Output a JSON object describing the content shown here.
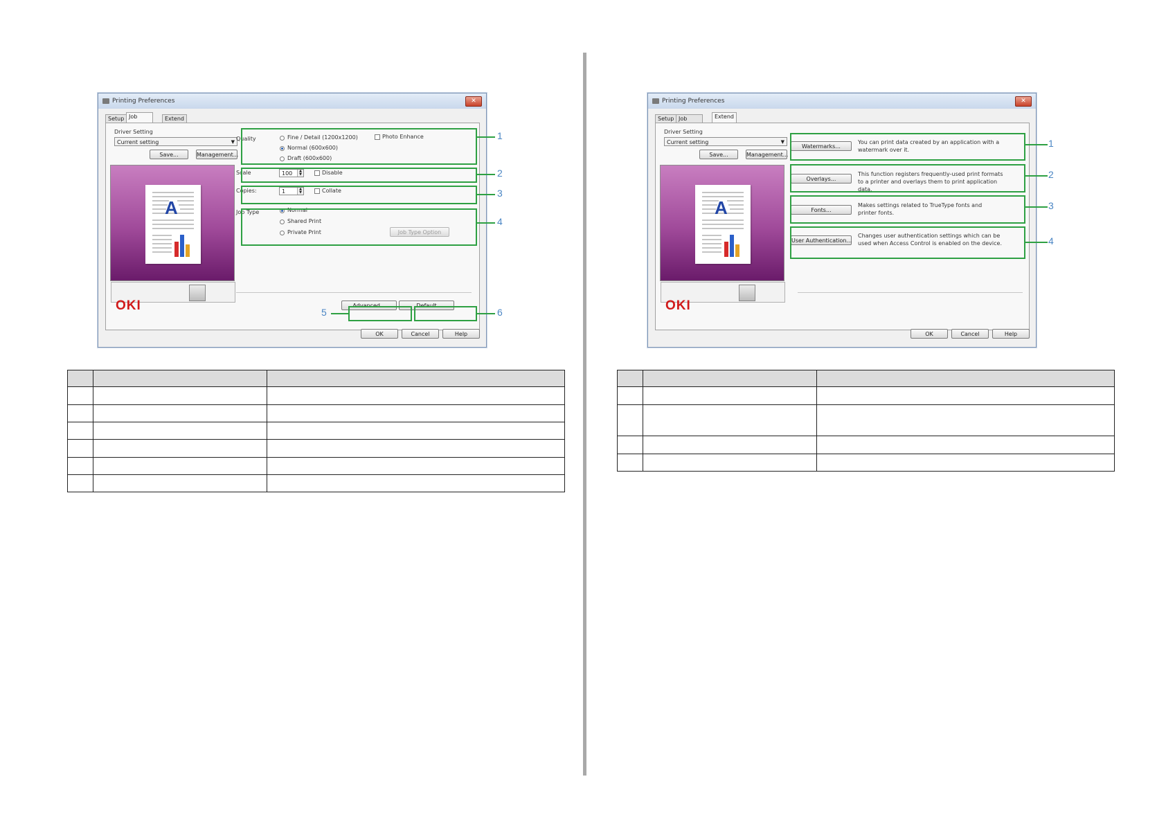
{
  "left": {
    "window_title": "Printing Preferences",
    "close_glyph": "✕",
    "tabs": [
      "Setup",
      "Job Options",
      "Extend"
    ],
    "driver_setting_label": "Driver Setting",
    "driver_setting_value": "Current setting",
    "save_label": "Save...",
    "management_label": "Management...",
    "quality_label": "Quality",
    "quality_options": [
      "Fine / Detail (1200x1200)",
      "Normal (600x600)",
      "Draft (600x600)"
    ],
    "photo_enhance_label": "Photo Enhance",
    "scale_label": "Scale",
    "scale_value": "100",
    "disable_label": "Disable",
    "copies_label": "Copies:",
    "copies_value": "1",
    "collate_label": "Collate",
    "job_type_label": "Job Type",
    "job_type_options": [
      "Normal",
      "Shared Print",
      "Private Print"
    ],
    "job_type_option_button": "Job Type Option",
    "advanced_label": "Advanced...",
    "default_label": "Default",
    "ok_label": "OK",
    "cancel_label": "Cancel",
    "help_label": "Help",
    "logo": "OKI",
    "preview_letter": "A",
    "callouts": [
      "1",
      "2",
      "3",
      "4",
      "5",
      "6"
    ]
  },
  "right": {
    "window_title": "Printing Preferences",
    "close_glyph": "✕",
    "tabs": [
      "Setup",
      "Job Options",
      "Extend"
    ],
    "driver_setting_label": "Driver Setting",
    "driver_setting_value": "Current setting",
    "save_label": "Save...",
    "management_label": "Management...",
    "watermarks_label": "Watermarks...",
    "watermarks_desc": "You can print data created by an application with a watermark over it.",
    "overlays_label": "Overlays...",
    "overlays_desc": "This function registers frequently-used print formats to a printer and overlays them to print application data.",
    "fonts_label": "Fonts...",
    "fonts_desc": "Makes settings related to TrueType fonts and printer fonts.",
    "user_auth_label": "User Authentication...",
    "user_auth_desc": "Changes user authentication settings which can be used when Access Control is enabled on the device.",
    "ok_label": "OK",
    "cancel_label": "Cancel",
    "help_label": "Help",
    "logo": "OKI",
    "preview_letter": "A",
    "callouts": [
      "1",
      "2",
      "3",
      "4"
    ]
  },
  "colors": {
    "callout_border": "#2ea043",
    "callout_number": "#4b86c4",
    "logo_red": "#d11a1a"
  }
}
